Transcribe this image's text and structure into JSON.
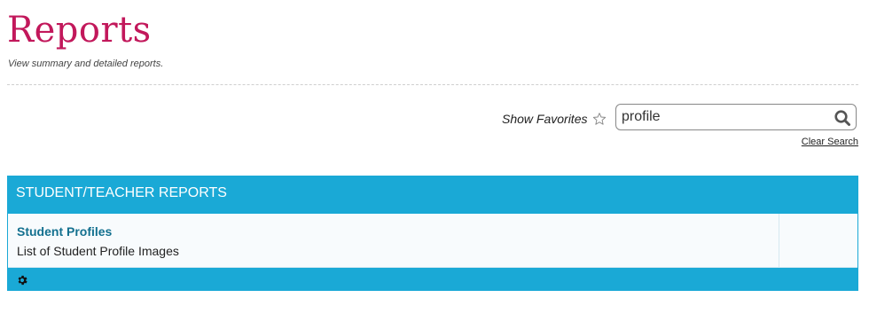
{
  "page": {
    "title": "Reports",
    "subtitle": "View summary and detailed reports."
  },
  "toolbar": {
    "favorites_label": "Show Favorites",
    "star_icon": "star-outline-icon"
  },
  "search": {
    "value": "profile",
    "icon": "search-icon",
    "clear_label": "Clear Search"
  },
  "report_group": {
    "title": "STUDENT/TEACHER REPORTS",
    "accent_color": "#1aa9d6",
    "reports": [
      {
        "name": "Student Profiles",
        "description": "List of Student Profile Images"
      }
    ],
    "footer_icon": "gear-icon"
  },
  "colors": {
    "title": "#c2185b",
    "link": "#13708f"
  }
}
